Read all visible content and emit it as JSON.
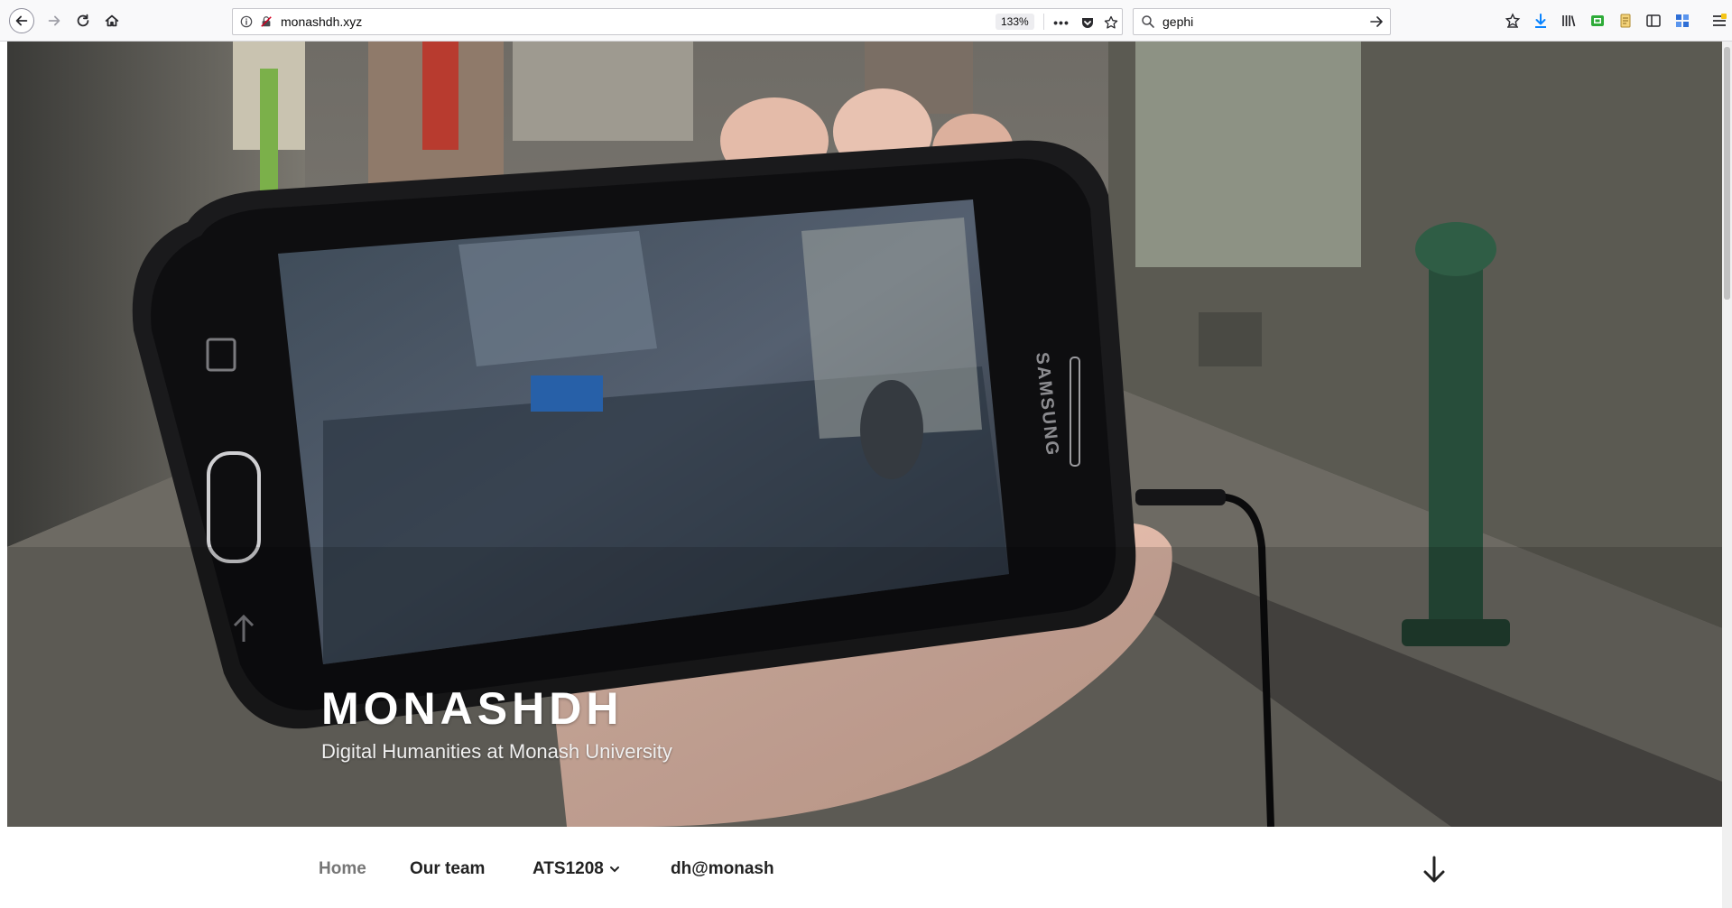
{
  "browser": {
    "url": "monashdh.xyz",
    "zoom": "133%",
    "search_query": "gephi",
    "more_label": "•••"
  },
  "site": {
    "title": "MONASHDH",
    "description": "Digital Humanities at Monash University",
    "nav": [
      {
        "label": "Home",
        "current": true
      },
      {
        "label": "Our team"
      },
      {
        "label": "ATS1208",
        "has_dropdown": true
      },
      {
        "label": "dh@monash"
      }
    ]
  },
  "phone_brand": "SAMSUNG",
  "icons": [
    "back-icon",
    "forward-icon",
    "reload-icon",
    "home-icon",
    "info-icon",
    "insecure-lock-icon",
    "more-icon",
    "pocket-icon",
    "bookmark-star-icon",
    "search-icon",
    "go-arrow-icon",
    "bookmarks-menu-icon",
    "download-icon",
    "library-icon",
    "extension-icon",
    "notes-icon",
    "sidebar-icon",
    "apps-icon",
    "menu-icon",
    "scroll-down-arrow-icon"
  ]
}
